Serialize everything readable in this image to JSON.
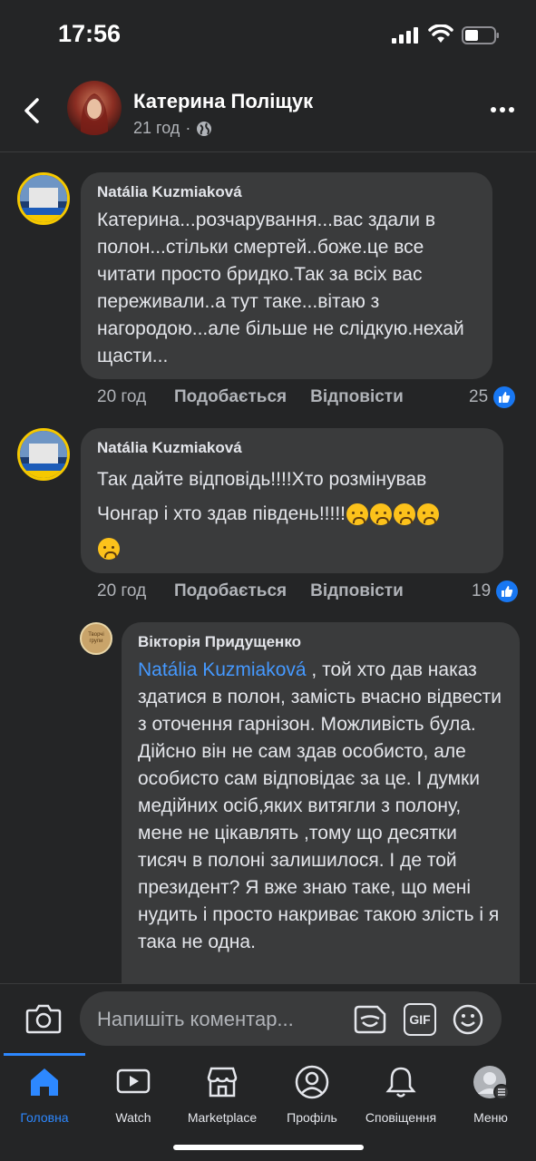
{
  "status": {
    "time": "17:56"
  },
  "header": {
    "name": "Катерина Поліщук",
    "time": "21 год",
    "separator": "·"
  },
  "comments": [
    {
      "author": "Natália Kuzmiaková",
      "text": "Катерина...розчарування...вас здали в полон...стільки смертей..боже.це все читати просто бридко.Так за всіх вас переживали..а тут таке...вітаю з нагородою...але більше не слідкую.нехай щасти...",
      "time": "20 год",
      "like_label": "Подобається",
      "reply_label": "Відповісти",
      "reactions": "25"
    },
    {
      "author": "Natália Kuzmiaková",
      "text_line1": "Так дайте відповідь!!!!Хто розмінував",
      "text_line2": "Чонгар і хто здав південь!!!!!",
      "time": "20 год",
      "like_label": "Подобається",
      "reply_label": "Відповісти",
      "reactions": "19"
    }
  ],
  "reply": {
    "author": "Вікторія Придущенко",
    "avatar_text": "Творчі групи",
    "mention": "Natália Kuzmiaková",
    "text": " , той хто дав наказ здатися в полон, замість вчасно відвести з оточення гарнізон. Можливість була. Дійсно він не сам здав особисто, але особисто сам відповідає за це. І думки медійних осіб,яких витягли з полону,  мене не цікавлять ,тому що десятки тисяч в полоні залишилося. І де той президент? Я вже знаю таке, що мені нудить і просто накриває такою злість і я така не одна."
  },
  "composer": {
    "placeholder": "Напишіть коментар...",
    "gif_label": "GIF"
  },
  "tabs": [
    {
      "label": "Головна",
      "icon": "home-icon",
      "active": true
    },
    {
      "label": "Watch",
      "icon": "watch-icon"
    },
    {
      "label": "Marketplace",
      "icon": "marketplace-icon"
    },
    {
      "label": "Профіль",
      "icon": "profile-icon"
    },
    {
      "label": "Сповіщення",
      "icon": "bell-icon"
    },
    {
      "label": "Меню",
      "icon": "menu-avatar-icon"
    }
  ],
  "colors": {
    "accent": "#2d88ff",
    "background": "#242526",
    "bubble": "#3a3b3c",
    "mention": "#4599ff"
  }
}
